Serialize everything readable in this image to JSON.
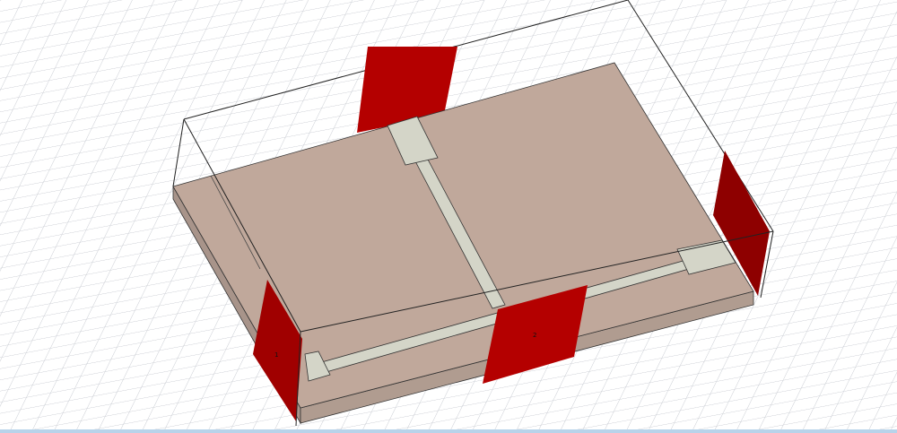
{
  "viewport": {
    "title": "3D model view",
    "colors": {
      "substrate": "#c0a89b",
      "substrate_side": "#a8948a",
      "trace": "#d4d5c8",
      "port": "#b40000",
      "port_dark": "#8e0000",
      "grid": "#c9ccd3"
    }
  },
  "ports": [
    {
      "name": "port-left",
      "label": "1"
    },
    {
      "name": "port-front",
      "label": "2"
    },
    {
      "name": "port-right",
      "label": ""
    },
    {
      "name": "port-back",
      "label": ""
    }
  ]
}
